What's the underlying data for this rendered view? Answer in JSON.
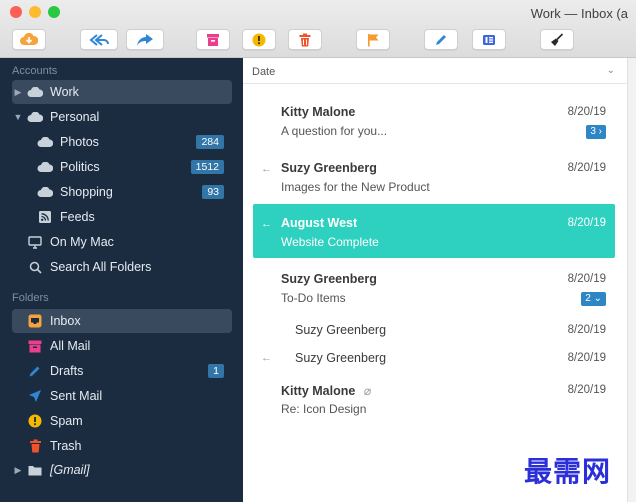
{
  "window": {
    "title": "Work — Inbox (a"
  },
  "toolbar": {
    "buttons": [
      "get-mail",
      "reply-all",
      "forward",
      "archive",
      "junk",
      "delete",
      "flag",
      "compose",
      "card",
      "broom"
    ]
  },
  "sidebar": {
    "accounts_heading": "Accounts",
    "accounts": [
      {
        "label": "Work",
        "disclosure": "▶",
        "icon": "cloud-icon",
        "selected": true
      },
      {
        "label": "Personal",
        "disclosure": "▼",
        "icon": "cloud-icon"
      },
      {
        "label": "Photos",
        "badge": "284",
        "icon": "cloud-icon"
      },
      {
        "label": "Politics",
        "badge": "1512",
        "icon": "cloud-icon"
      },
      {
        "label": "Shopping",
        "badge": "93",
        "icon": "cloud-icon"
      },
      {
        "label": "Feeds",
        "icon": "rss-icon"
      },
      {
        "label": "On My Mac",
        "icon": "monitor-icon"
      },
      {
        "label": "Search All Folders",
        "icon": "search-icon"
      }
    ],
    "folders_heading": "Folders",
    "folders": [
      {
        "label": "Inbox",
        "icon": "inbox-icon",
        "selected": true
      },
      {
        "label": "All Mail",
        "icon": "archive-icon"
      },
      {
        "label": "Drafts",
        "badge": "1",
        "icon": "pencil-icon"
      },
      {
        "label": "Sent Mail",
        "icon": "send-icon"
      },
      {
        "label": "Spam",
        "icon": "spam-icon"
      },
      {
        "label": "Trash",
        "icon": "trash-icon"
      },
      {
        "label": "[Gmail]",
        "disclosure": "▶",
        "icon": "folder-icon"
      }
    ]
  },
  "list": {
    "sort_label": "Date",
    "sort_chevron": "⌄",
    "messages": [
      {
        "from": "Kitty Malone",
        "subject": "A question for you...",
        "date": "8/20/19",
        "count": "3 ›"
      },
      {
        "from": "Suzy Greenberg",
        "subject": "Images for the New Product",
        "date": "8/20/19",
        "arrow": "←"
      },
      {
        "from": "August West",
        "subject": "Website Complete",
        "date": "8/20/19",
        "arrow": "←",
        "selected": true
      },
      {
        "from": "Suzy Greenberg",
        "subject": "To-Do Items",
        "date": "8/20/19",
        "count": "2 ⌄"
      },
      {
        "from": "Suzy Greenberg",
        "date": "8/20/19"
      },
      {
        "from": "Suzy Greenberg",
        "date": "8/20/19",
        "arrow": "←"
      },
      {
        "from": "Kitty Malone",
        "subject": "Re: Icon Design",
        "date": "8/20/19",
        "attachment": "⌀"
      }
    ]
  },
  "watermark": "最需网",
  "colors": {
    "sidebar_bg": "#1c2c40",
    "accent_teal": "#2ed1bf",
    "badge_blue": "#3276a8",
    "toolbar_orange": "#f5a33a",
    "toolbar_pink": "#ea3f8c",
    "toolbar_blue": "#2f86d6"
  }
}
